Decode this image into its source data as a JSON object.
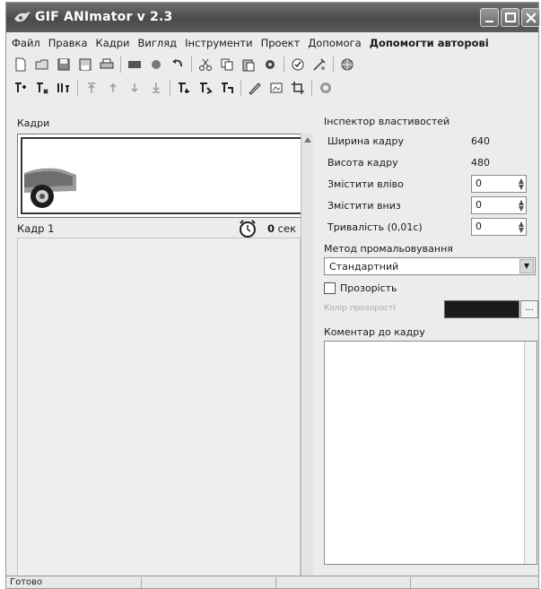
{
  "window": {
    "title": "GIF ANImator v 2.3"
  },
  "menu": [
    "Файл",
    "Правка",
    "Кадри",
    "Вигляд",
    "Інструменти",
    "Проект",
    "Допомога"
  ],
  "menu_bold": "Допомогти авторові",
  "toolbar1": [
    "new-file-icon",
    "open-icon",
    "save-icon",
    "save-as-icon",
    "print-icon",
    "image-icon",
    "paint-icon",
    "undo-icon",
    "cut-icon",
    "copy-icon",
    "paste-icon",
    "settings-icon",
    "wizard-icon",
    "optimize-icon",
    "web-icon"
  ],
  "toolbar2": [
    "insert-frame-icon",
    "add-frame-icon",
    "frame-props-icon",
    "move-top-icon",
    "move-up-icon",
    "move-down-icon",
    "move-bottom-icon",
    "split-frame-icon",
    "merge-frame-icon",
    "resize-frame-icon",
    "edit-icon",
    "preview-icon",
    "crop-icon",
    "play-icon"
  ],
  "frames_panel": {
    "title": "Кадри",
    "frame_label": "Кадр 1",
    "delay_value": "0",
    "delay_unit": "сек"
  },
  "inspector": {
    "title": "Інспектор властивостей",
    "width_label": "Ширина кадру",
    "width_value": "640",
    "height_label": "Висота кадру",
    "height_value": "480",
    "left_label": "Змістити вліво",
    "left_value": "0",
    "down_label": "Змістити вниз",
    "down_value": "0",
    "duration_label": "Тривалість (0,01с)",
    "duration_value": "0",
    "method_label": "Метод промальовування",
    "method_value": "Стандартний",
    "transparency_label": "Прозорість",
    "transparency_checked": false,
    "transparency_color_label": "Колір прозорості",
    "transparency_color": "#1a1a1a",
    "color_button": "...",
    "comment_label": "Коментар до кадру",
    "comment_value": ""
  },
  "status": {
    "text": "Готово"
  }
}
